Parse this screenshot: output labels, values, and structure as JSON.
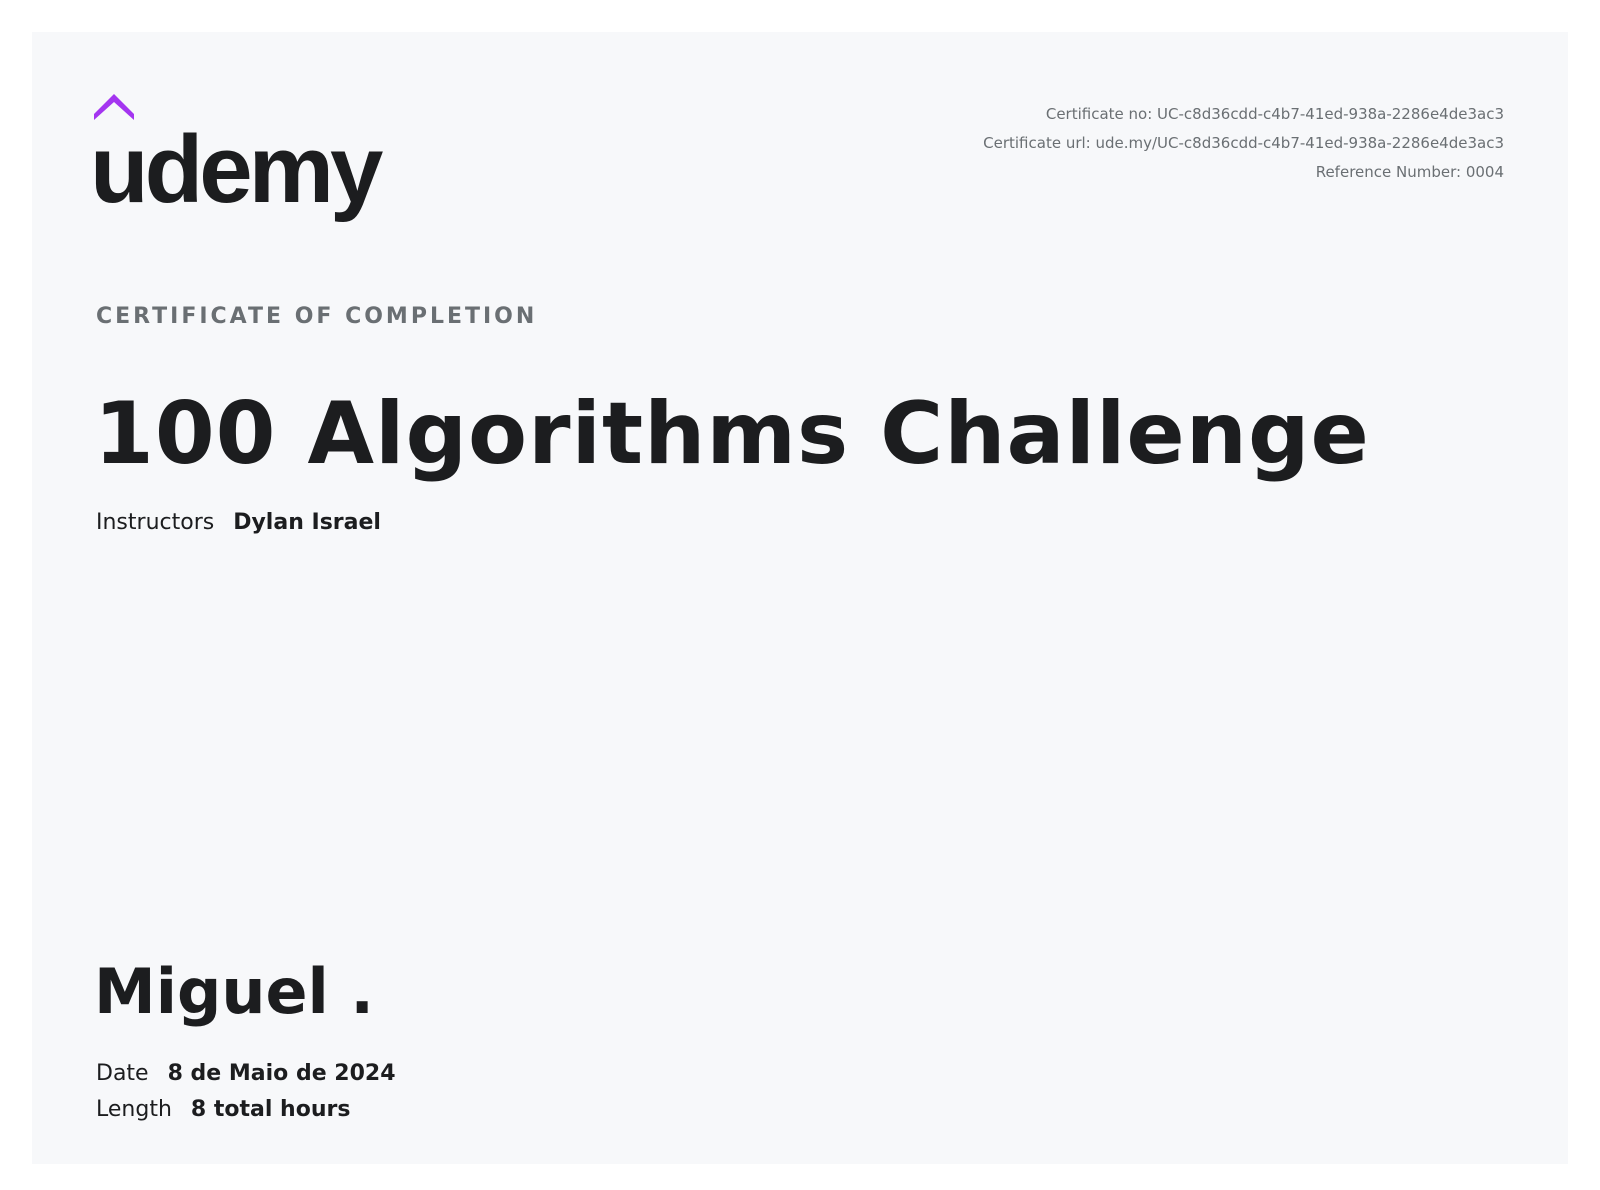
{
  "logo": {
    "brand": "udemy",
    "accent_color": "#a435f0",
    "text_color": "#1c1d1f",
    "icon": "udemy-hat-icon"
  },
  "certificate_meta": {
    "number": "Certificate no: UC-c8d36cdd-c4b7-41ed-938a-2286e4de3ac3",
    "url": "Certificate url: ude.my/UC-c8d36cdd-c4b7-41ed-938a-2286e4de3ac3",
    "reference": "Reference Number: 0004"
  },
  "heading": "CERTIFICATE OF COMPLETION",
  "course_title": "100 Algorithms Challenge",
  "instructors": {
    "label": "Instructors",
    "value": "Dylan Israel"
  },
  "student_name": "Miguel .",
  "details": {
    "date_label": "Date",
    "date_value": "8 de Maio de 2024",
    "length_label": "Length",
    "length_value": "8 total hours"
  },
  "colors": {
    "background": "#f7f8fa",
    "page": "#ffffff",
    "text_primary": "#1c1d1f",
    "text_secondary": "#6a6f73"
  }
}
